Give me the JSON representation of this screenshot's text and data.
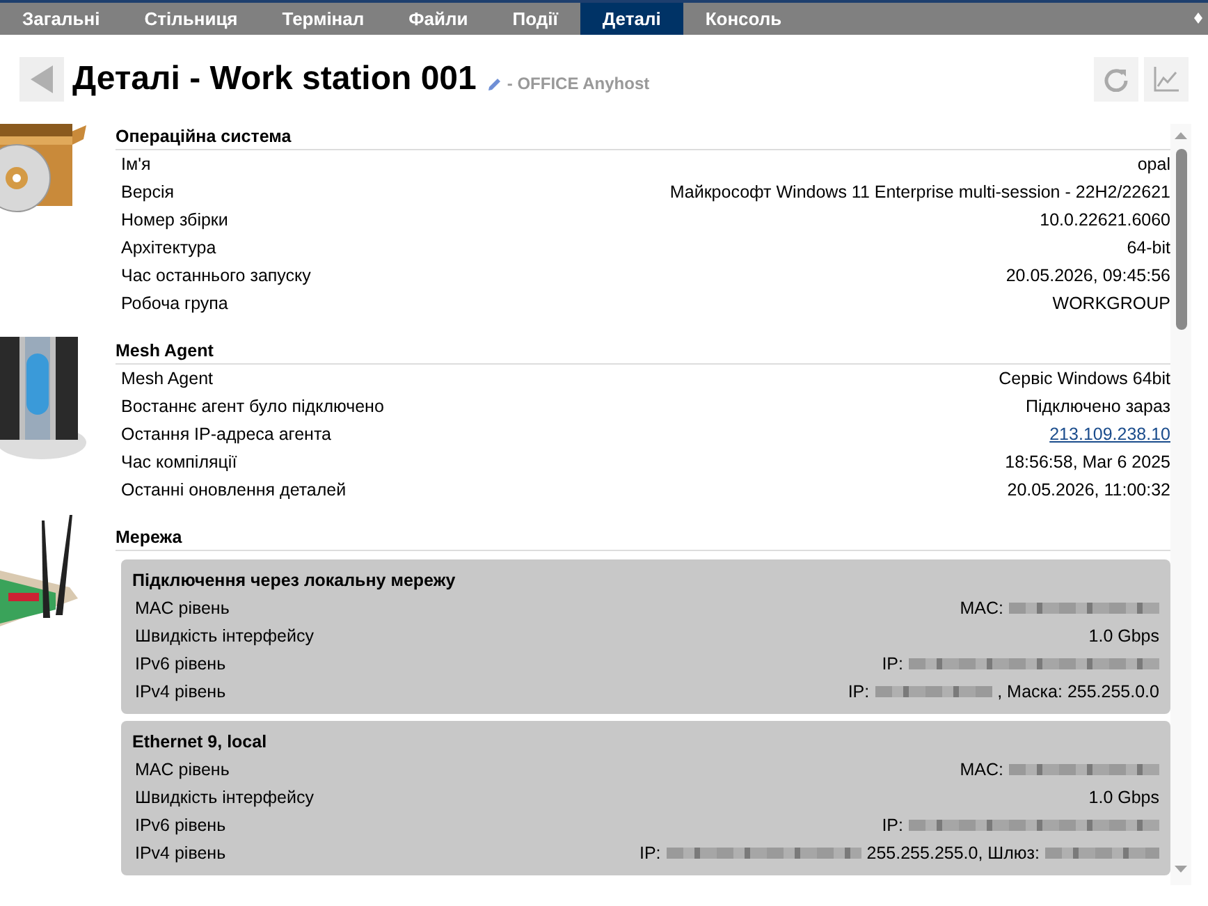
{
  "tabs": [
    {
      "label": "Загальні",
      "selected": false
    },
    {
      "label": "Стільниця",
      "selected": false
    },
    {
      "label": "Термінал",
      "selected": false
    },
    {
      "label": "Файли",
      "selected": false
    },
    {
      "label": "Події",
      "selected": false
    },
    {
      "label": "Деталі",
      "selected": true
    },
    {
      "label": "Консоль",
      "selected": false
    }
  ],
  "header": {
    "title": "Деталі - Work station 001",
    "subtitle": "- OFFICE Anyhost"
  },
  "sections": [
    {
      "title": "Операційна система",
      "kind": "table",
      "rows": [
        {
          "label": "Ім'я",
          "value": "opal",
          "kind": "text"
        },
        {
          "label": "Версія",
          "value": "Майкрософт Windows 11 Enterprise multi-session - 22H2/22621",
          "kind": "text"
        },
        {
          "label": "Номер збірки",
          "value": "10.0.22621.6060",
          "kind": "text"
        },
        {
          "label": "Архітектура",
          "value": "64-bit",
          "kind": "text"
        },
        {
          "label": "Час останнього запуску",
          "value": "20.05.2026, 09:45:56",
          "kind": "text"
        },
        {
          "label": "Робоча група",
          "value": "WORKGROUP",
          "kind": "text"
        }
      ]
    },
    {
      "title": "Mesh Agent",
      "kind": "table",
      "rows": [
        {
          "label": "Mesh Agent",
          "value": "Сервіс Windows 64bit",
          "kind": "text"
        },
        {
          "label": "Востаннє агент було підключено",
          "value": "Підключено зараз",
          "kind": "text"
        },
        {
          "label": "Остання IP-адреса агента",
          "value": "213.109.238.10",
          "kind": "link"
        },
        {
          "label": "Час компіляції",
          "value": "18:56:58, Mar 6 2025",
          "kind": "text"
        },
        {
          "label": "Останні оновлення деталей",
          "value": "20.05.2026, 11:00:32",
          "kind": "text"
        }
      ]
    },
    {
      "title": "Мережа",
      "kind": "interfaces",
      "interfaces": [
        {
          "name": "Підключення через локальну мережу",
          "rows": [
            {
              "label": "MAC рівень",
              "parts": [
                {
                  "kind": "text",
                  "text": "MAC:"
                },
                {
                  "kind": "redacted"
                }
              ]
            },
            {
              "label": "Швидкість інтерфейсу",
              "parts": [
                {
                  "kind": "text",
                  "text": "1.0 Gbps"
                }
              ]
            },
            {
              "label": "IPv6 рівень",
              "parts": [
                {
                  "kind": "text",
                  "text": "IP:"
                },
                {
                  "kind": "redacted"
                }
              ]
            },
            {
              "label": "IPv4 рівень",
              "parts": [
                {
                  "kind": "text",
                  "text": "IP:"
                },
                {
                  "kind": "redacted"
                },
                {
                  "kind": "text",
                  "text": ", Маска: 255.255.0.0"
                }
              ]
            }
          ]
        },
        {
          "name": "Ethernet 9, local",
          "rows": [
            {
              "label": "MAC рівень",
              "parts": [
                {
                  "kind": "text",
                  "text": "MAC:"
                },
                {
                  "kind": "redacted"
                }
              ]
            },
            {
              "label": "Швидкість інтерфейсу",
              "parts": [
                {
                  "kind": "text",
                  "text": "1.0 Gbps"
                }
              ]
            },
            {
              "label": "IPv6 рівень",
              "parts": [
                {
                  "kind": "text",
                  "text": "IP:"
                },
                {
                  "kind": "redacted"
                }
              ]
            },
            {
              "label": "IPv4 рівень",
              "parts": [
                {
                  "kind": "text",
                  "text": "IP:"
                },
                {
                  "kind": "redacted"
                },
                {
                  "kind": "text",
                  "text": "255.255.255.0, Шлюз:"
                },
                {
                  "kind": "redacted"
                }
              ]
            }
          ]
        }
      ]
    }
  ]
}
